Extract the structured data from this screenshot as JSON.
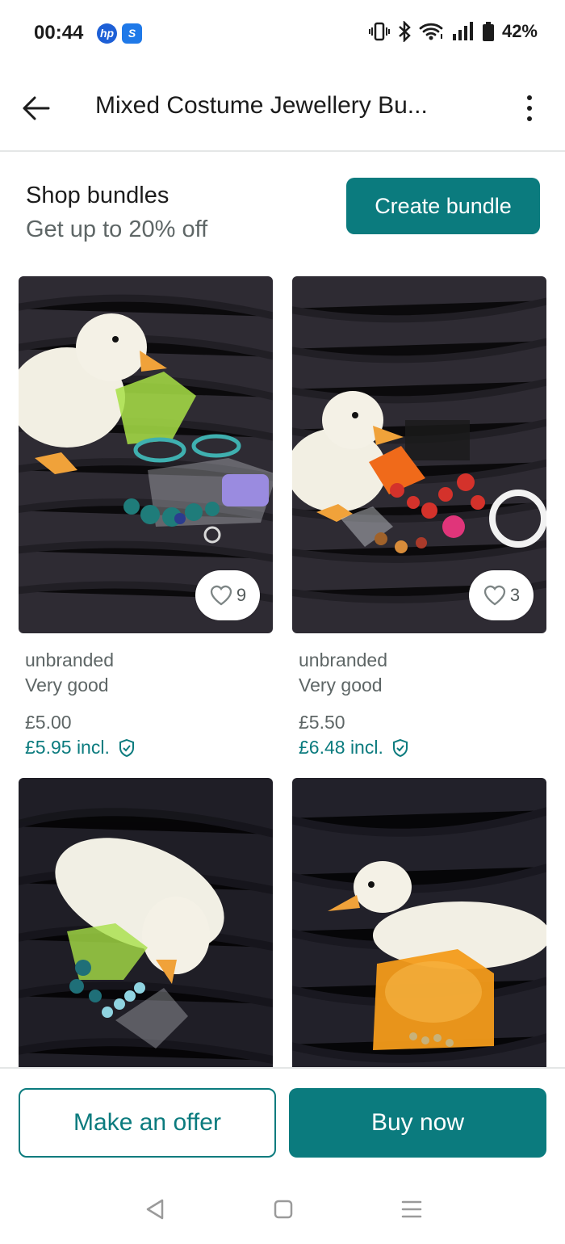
{
  "status_bar": {
    "time": "00:44",
    "battery": "42%",
    "icons": [
      "hp-app-icon",
      "shazam-icon",
      "vibrate-icon",
      "bluetooth-icon",
      "wifi-icon",
      "signal-icon",
      "battery-icon"
    ]
  },
  "header": {
    "title": "Mixed Costume Jewellery Bu...",
    "back_icon": "arrow-left-icon",
    "more_icon": "more-vertical-icon"
  },
  "bundle": {
    "title": "Shop bundles",
    "subtitle": "Get up to 20% off",
    "create_label": "Create bundle"
  },
  "items": [
    {
      "brand": "unbranded",
      "condition": "Very good",
      "price": "£5.00",
      "price_incl": "£5.95 incl.",
      "favourites": "9"
    },
    {
      "brand": "unbranded",
      "condition": "Very good",
      "price": "£5.50",
      "price_incl": "£6.48 incl.",
      "favourites": "3"
    }
  ],
  "actions": {
    "offer_label": "Make an offer",
    "buy_label": "Buy now"
  },
  "colors": {
    "accent": "#0b7b7e",
    "text_secondary": "#5e6666",
    "photo_background": "#2e2b33"
  },
  "nav_bar": {
    "icons": [
      "back-triangle-icon",
      "home-square-icon",
      "recents-lines-icon"
    ]
  }
}
